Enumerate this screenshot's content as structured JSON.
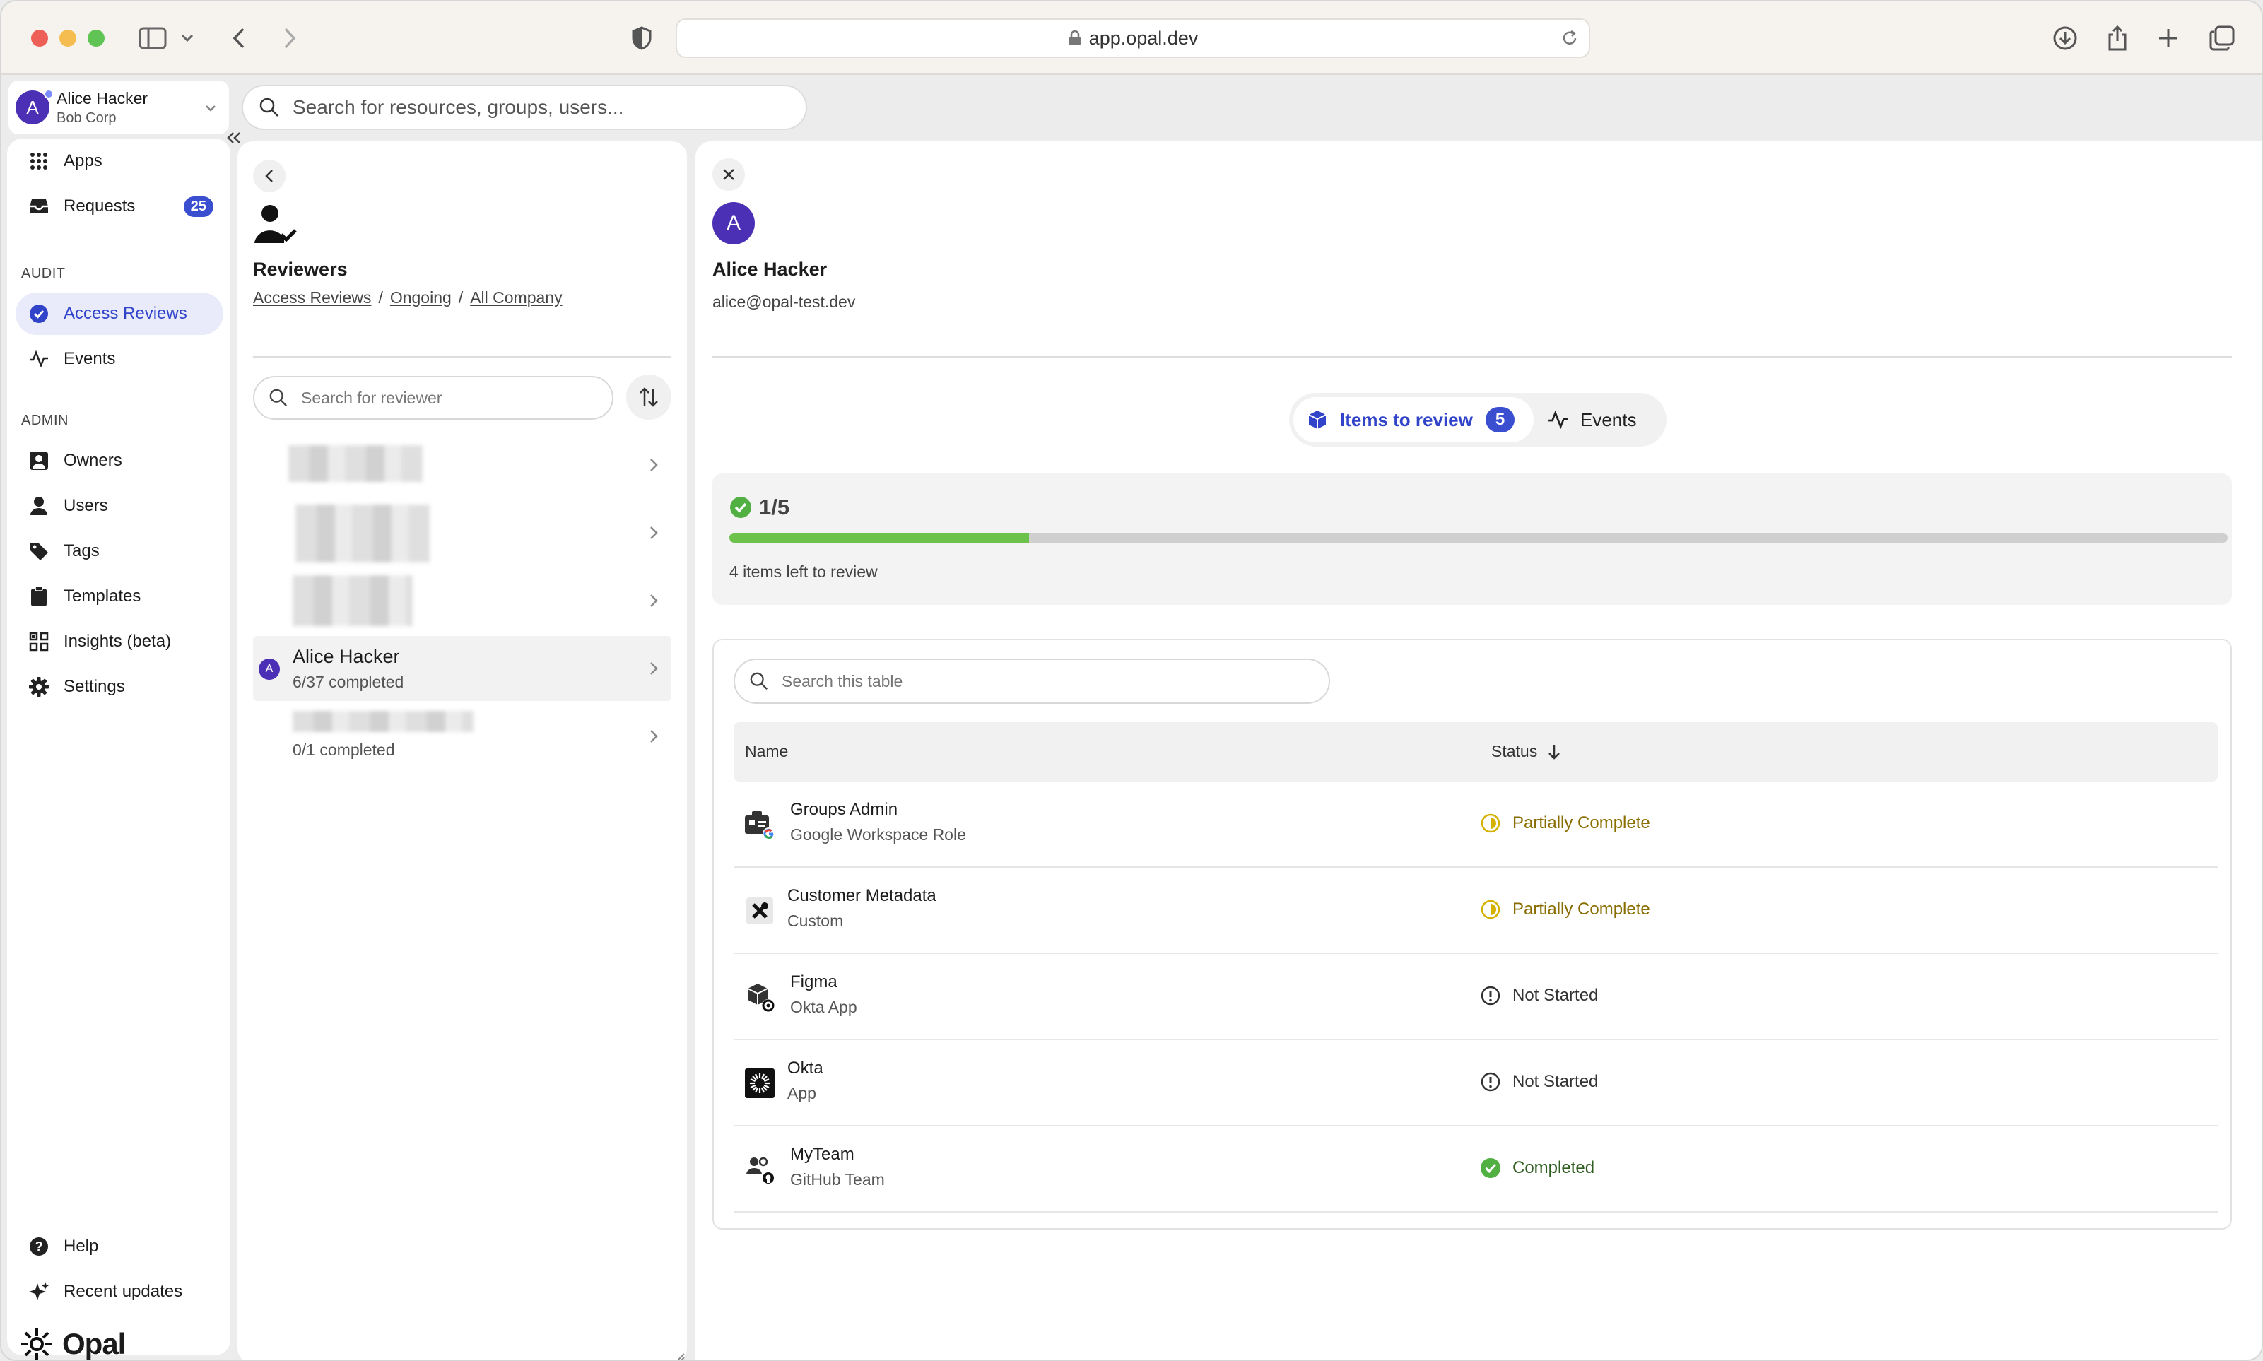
{
  "browser": {
    "url": "app.opal.dev"
  },
  "account": {
    "name": "Alice Hacker",
    "org": "Bob Corp",
    "initial": "A"
  },
  "top_search": {
    "placeholder": "Search for resources, groups, users..."
  },
  "sidebar": {
    "apps": "Apps",
    "requests": "Requests",
    "requests_count": "25",
    "audit_header": "AUDIT",
    "access_reviews": "Access Reviews",
    "events": "Events",
    "admin_header": "ADMIN",
    "owners": "Owners",
    "users": "Users",
    "tags": "Tags",
    "templates": "Templates",
    "insights": "Insights (beta)",
    "settings": "Settings",
    "help": "Help",
    "recent_updates": "Recent updates",
    "logo_text": "Opal"
  },
  "reviewers": {
    "title": "Reviewers",
    "breadcrumb": [
      "Access Reviews",
      "Ongoing",
      "All Company"
    ],
    "search_placeholder": "Search for reviewer",
    "selected": {
      "name": "Alice Hacker",
      "initial": "A",
      "progress": "6/37 completed"
    },
    "last_progress": "0/1 completed"
  },
  "detail": {
    "initial": "A",
    "name": "Alice Hacker",
    "email": "alice@opal-test.dev",
    "tab_items": "Items to review",
    "tab_items_count": "5",
    "tab_events": "Events",
    "progress_label": "1/5",
    "progress_fraction": 0.2,
    "progress_note": "4 items left to review",
    "table_search_placeholder": "Search this table",
    "col_name": "Name",
    "col_status": "Status",
    "rows": [
      {
        "name": "Groups Admin",
        "type": "Google Workspace Role",
        "status": "Partially Complete",
        "status_color": "#8a6d00"
      },
      {
        "name": "Customer Metadata",
        "type": "Custom",
        "status": "Partially Complete",
        "status_color": "#8a6d00"
      },
      {
        "name": "Figma",
        "type": "Okta App",
        "status": "Not Started",
        "status_color": "#333333"
      },
      {
        "name": "Okta",
        "type": "App",
        "status": "Not Started",
        "status_color": "#333333"
      },
      {
        "name": "MyTeam",
        "type": "GitHub Team",
        "status": "Completed",
        "status_color": "#2e5d1f"
      }
    ]
  },
  "colors": {
    "accent": "#3043c9",
    "avatar": "#4b2fb5",
    "progress_fill": "#6cc24a",
    "partial": "#d4b100",
    "complete": "#52b043"
  }
}
